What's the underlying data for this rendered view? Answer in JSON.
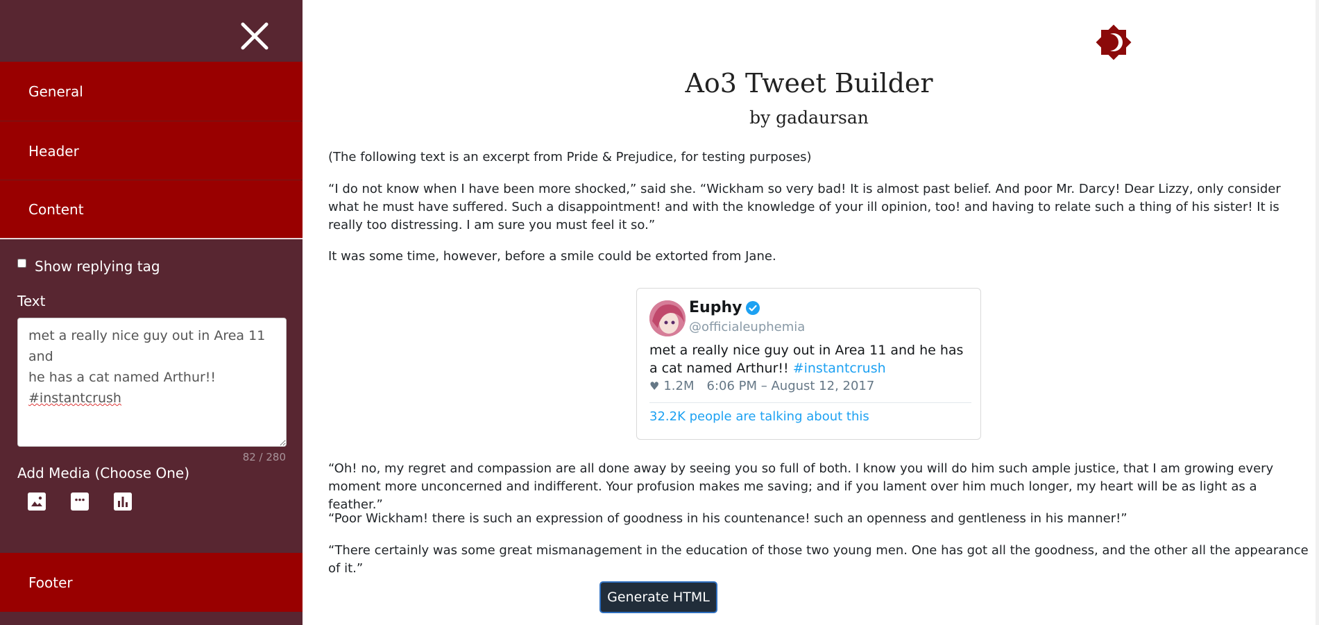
{
  "sidebar": {
    "nav": {
      "general": "General",
      "header": "Header",
      "content": "Content",
      "footer": "Footer"
    },
    "content_panel": {
      "replying_tag_label": "Show replying tag",
      "replying_tag_checked": false,
      "text_label": "Text",
      "text_line1": "met a really nice guy out in Area 11 and",
      "text_line2": "he has a cat named Arthur!!",
      "text_line3": "#instantcrush",
      "char_counter": "82 / 280",
      "media_label": "Add Media (Choose One)",
      "media_icons": [
        "image-icon",
        "quote-icon",
        "poll-icon"
      ]
    }
  },
  "main": {
    "title": "Ao3 Tweet Builder",
    "subtitle": "by gadaursan",
    "paragraphs_before": [
      "(The following text is an excerpt from Pride & Prejudice, for testing purposes)",
      "“I do not know when I have been more shocked,” said she. “Wickham so very bad! It is almost past belief. And poor Mr. Darcy! Dear Lizzy, only consider what he must have suffered. Such a disappointment! and with the knowledge of your ill opinion, too! and having to relate such a thing of his sister! It is really too distressing. I am sure you must feel it so.”",
      "It was some time, however, before a smile could be extorted from Jane."
    ],
    "tweet": {
      "name": "Euphy",
      "handle": "@officialeuphemia",
      "text": "met a really nice guy out in Area 11 and he has a cat named Arthur!!",
      "hashtag": "#instantcrush",
      "likes": "1.2M",
      "timestamp": "6:06 PM – August 12, 2017",
      "talking": "32.2K people are talking about this"
    },
    "paragraphs_after": [
      "“Oh! no, my regret and compassion are all done away by seeing you so full of both. I know you will do him such ample justice, that I am growing every moment more unconcerned and indifferent. Your profusion makes me saving; and if you lament over him much longer, my heart will be as light as a feather.”",
      "“Poor Wickham! there is such an expression of goodness in his countenance! such an openness and gentleness in his manner!”",
      "“There certainly was some great mismanagement in the education of those two young men. One has got all the goodness, and the other all the appearance of it.”"
    ],
    "generate_button": "Generate HTML"
  },
  "colors": {
    "sidebar_bg": "#582631",
    "nav_bg": "#990000",
    "link_blue": "#1da1f2",
    "button_bg": "#212d3a"
  }
}
